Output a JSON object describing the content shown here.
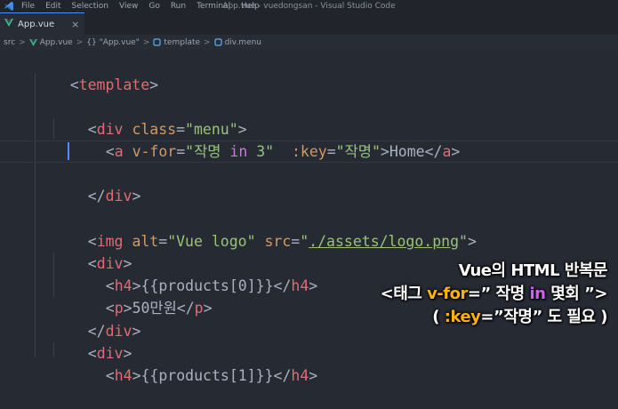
{
  "titlebar": {
    "menu": [
      "File",
      "Edit",
      "Selection",
      "View",
      "Go",
      "Run",
      "Terminal",
      "Help"
    ],
    "window_title": "App.vue - vuedongsan - Visual Studio Code"
  },
  "tab": {
    "label": "App.vue",
    "close": "×",
    "icon": "vue-icon"
  },
  "breadcrumb": {
    "items": [
      "src",
      "App.vue",
      "{} \"App.vue\"",
      "template",
      "div.menu"
    ],
    "separator": ">"
  },
  "code": {
    "l1_tag": "template",
    "l2_tag": "div",
    "l2_attr": "class",
    "l2_val": "\"menu\"",
    "l3_tag": "a",
    "l3_attr": "v-for",
    "l3_val_a": "\"작명 ",
    "l3_in": "in",
    "l3_val_b": " 3\"",
    "l3_key": ":key",
    "l3_key_val": "\"작명\"",
    "l3_text": "Home",
    "l3_close": "a",
    "l5_tag": "div",
    "l7_tag": "img",
    "l7_alt": "alt",
    "l7_alt_val": "\"Vue logo\"",
    "l7_src": "src",
    "l7_src_q1": "\"",
    "l7_src_path": "./assets/logo.png",
    "l7_src_q2": "\"",
    "l8_tag": "div",
    "l9_tag": "h4",
    "l9_text": "{{products[0]}}",
    "l10_tag": "p",
    "l10_text": "50만원",
    "l11_tag": "div",
    "l12_tag": "div",
    "l13_tag": "h4",
    "l13_text": "{{products[1]}}"
  },
  "caption": {
    "line1": "Vue의 HTML 반복문",
    "line2_a": "<태그 ",
    "line2_vfor": "v-for",
    "line2_b": "=” 작명 ",
    "line2_in": "in",
    "line2_c": " 몇회 ”>",
    "line3_a": "( ",
    "line3_key": ":key",
    "line3_b": "=”작명” 도 필요 )"
  },
  "colors": {
    "tag": "#e06c75",
    "attr": "#d19a66",
    "string": "#98c379",
    "keyword": "#c678dd",
    "caption_yellow": "#ffb300",
    "caption_purple": "#d65cff"
  }
}
